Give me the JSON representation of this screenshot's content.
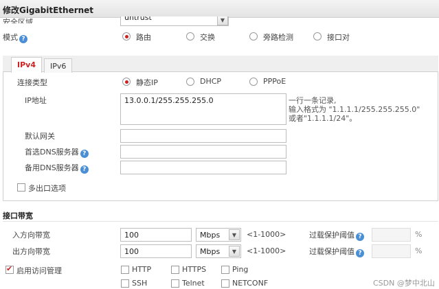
{
  "window": {
    "title": "修改GigabitEthernet"
  },
  "zone": {
    "label": "安全区域",
    "value": "untrust"
  },
  "mode": {
    "label": "模式",
    "options": [
      "路由",
      "交换",
      "旁路检测",
      "接口对"
    ],
    "selected": 0
  },
  "tabs": {
    "items": [
      "IPv4",
      "IPv6"
    ],
    "active": 0
  },
  "ipv4": {
    "conn_type_label": "连接类型",
    "conn_options": [
      "静态IP",
      "DHCP",
      "PPPoE"
    ],
    "conn_selected": 0,
    "ip_label": "IP地址",
    "ip_value": "13.0.0.1/255.255.255.0",
    "ip_hint": [
      "一行一条记录,",
      "输入格式为 \"1.1.1.1/255.255.255.0\"",
      "或者\"1.1.1.1/24\"。"
    ],
    "gateway_label": "默认网关",
    "gateway_value": "",
    "dns1_label": "首选DNS服务器",
    "dns1_value": "",
    "dns2_label": "备用DNS服务器",
    "dns2_value": "",
    "multi_exit_label": "多出口选项"
  },
  "bandwidth": {
    "section_title": "接口带宽",
    "inbound_label": "入方向带宽",
    "inbound_value": "100",
    "inbound_unit": "Mbps",
    "inbound_range": "<1-1000>",
    "inbound_threshold_label": "过载保护阈值",
    "inbound_threshold_value": "",
    "outbound_label": "出方向带宽",
    "outbound_value": "100",
    "outbound_unit": "Mbps",
    "outbound_range": "<1-1000>",
    "outbound_threshold_label": "过载保护阈值",
    "outbound_threshold_value": "",
    "percent": "%"
  },
  "access": {
    "enable_label": "启用访问管理",
    "enabled": true,
    "protocols": [
      "HTTP",
      "HTTPS",
      "Ping",
      "SSH",
      "Telnet",
      "NETCONF"
    ]
  },
  "watermark": "CSDN @梦中北山",
  "colors": {
    "accent": "#cc2222",
    "help": "#4a8fd6"
  }
}
